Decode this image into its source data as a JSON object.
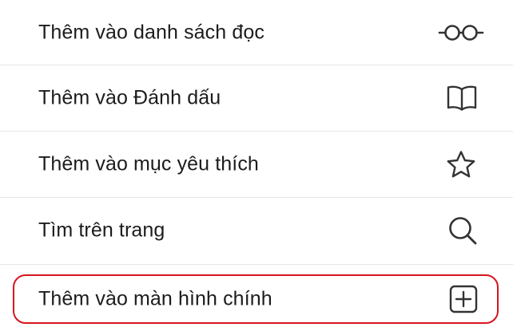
{
  "menu": {
    "items": [
      {
        "label": "Thêm vào danh sách đọc",
        "icon": "glasses-icon"
      },
      {
        "label": "Thêm vào Đánh dấu",
        "icon": "book-icon"
      },
      {
        "label": "Thêm vào mục yêu thích",
        "icon": "star-icon"
      },
      {
        "label": "Tìm trên trang",
        "icon": "search-icon"
      },
      {
        "label": "Thêm vào màn hình chính",
        "icon": "add-square-icon"
      }
    ]
  },
  "colors": {
    "text": "#1c1c1e",
    "icon": "#333333",
    "divider": "#e6e6ea",
    "highlight_border": "#d8141d",
    "background": "#ffffff"
  }
}
